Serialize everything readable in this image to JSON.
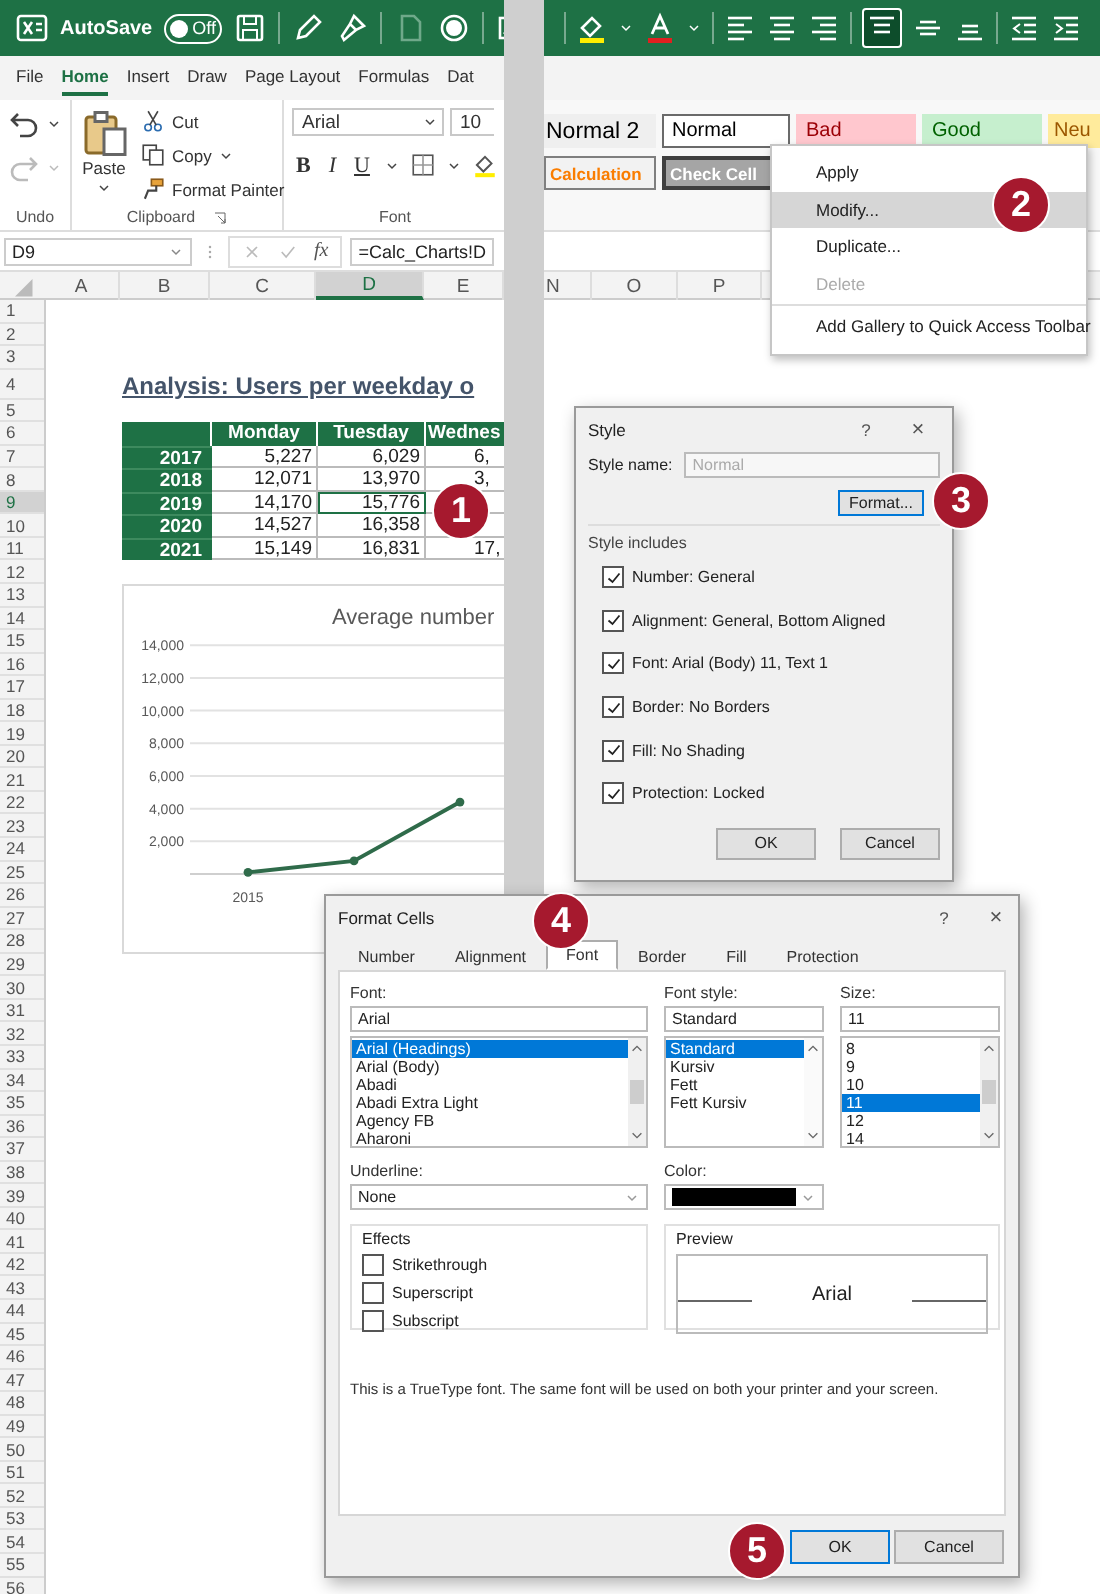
{
  "title_bar": {
    "autosave_label": "AutoSave",
    "autosave_state": "Off",
    "autosave_on": false,
    "vertical_align_buttons": [
      {
        "selected": true
      },
      {
        "selected": false
      },
      {
        "selected": false
      }
    ]
  },
  "menu_tabs": [
    {
      "label": "File",
      "selected": false
    },
    {
      "label": "Home",
      "selected": true
    },
    {
      "label": "Insert",
      "selected": false
    },
    {
      "label": "Draw",
      "selected": false
    },
    {
      "label": "Page Layout",
      "selected": false
    },
    {
      "label": "Formulas",
      "selected": false
    },
    {
      "label": "Dat",
      "selected": false
    }
  ],
  "ribbon": {
    "undo_group": "Undo",
    "paste": "Paste",
    "cut": "Cut",
    "copy": "Copy",
    "format_painter": "Format Painter",
    "clipboard_group": "Clipboard",
    "font_name": "Arial",
    "font_size": "10",
    "bold": "B",
    "italic": "I",
    "underline": "U",
    "font_group": "Font",
    "cell_styles": [
      {
        "label": "Normal 2",
        "kind": "plain",
        "selected": false
      },
      {
        "label": "Normal",
        "kind": "normal",
        "selected": true
      },
      {
        "label": "Bad",
        "kind": "bad",
        "selected": false
      },
      {
        "label": "Good",
        "kind": "good",
        "selected": false
      },
      {
        "label": "Neu",
        "kind": "neutral",
        "selected": false
      },
      {
        "label": "Calculation",
        "kind": "calculation",
        "selected": false
      },
      {
        "label": "Check Cell",
        "kind": "check",
        "selected": false
      }
    ]
  },
  "formula_bar": {
    "name_box": "D9",
    "fx": "fx",
    "formula": "=Calc_Charts!D"
  },
  "columns": [
    {
      "label": "A",
      "selected": false
    },
    {
      "label": "B",
      "selected": false
    },
    {
      "label": "C",
      "selected": false
    },
    {
      "label": "D",
      "selected": true
    },
    {
      "label": "E",
      "selected": false
    },
    {
      "label": "N",
      "selected": false
    },
    {
      "label": "O",
      "selected": false
    },
    {
      "label": "P",
      "selected": false
    }
  ],
  "rows": [
    {
      "label": "1",
      "selected": false
    },
    {
      "label": "2",
      "selected": false
    },
    {
      "label": "3",
      "selected": false
    },
    {
      "label": "4",
      "selected": false
    },
    {
      "label": "5",
      "selected": false
    },
    {
      "label": "6",
      "selected": false
    },
    {
      "label": "7",
      "selected": false
    },
    {
      "label": "8",
      "selected": false
    },
    {
      "label": "9",
      "selected": true
    },
    {
      "label": "10",
      "selected": false
    },
    {
      "label": "11",
      "selected": false
    },
    {
      "label": "12",
      "selected": false
    },
    {
      "label": "13",
      "selected": false
    },
    {
      "label": "14",
      "selected": false
    },
    {
      "label": "15",
      "selected": false
    },
    {
      "label": "16",
      "selected": false
    },
    {
      "label": "17",
      "selected": false
    },
    {
      "label": "18",
      "selected": false
    },
    {
      "label": "19",
      "selected": false
    },
    {
      "label": "20",
      "selected": false
    },
    {
      "label": "21",
      "selected": false
    },
    {
      "label": "22",
      "selected": false
    },
    {
      "label": "23",
      "selected": false
    },
    {
      "label": "24",
      "selected": false
    },
    {
      "label": "25",
      "selected": false
    },
    {
      "label": "26",
      "selected": false
    },
    {
      "label": "27",
      "selected": false
    },
    {
      "label": "28",
      "selected": false
    },
    {
      "label": "29",
      "selected": false
    },
    {
      "label": "30",
      "selected": false
    },
    {
      "label": "31",
      "selected": false
    },
    {
      "label": "32",
      "selected": false
    },
    {
      "label": "33",
      "selected": false
    },
    {
      "label": "34",
      "selected": false
    },
    {
      "label": "35",
      "selected": false
    },
    {
      "label": "36",
      "selected": false
    },
    {
      "label": "37",
      "selected": false
    },
    {
      "label": "38",
      "selected": false
    },
    {
      "label": "39",
      "selected": false
    },
    {
      "label": "40",
      "selected": false
    },
    {
      "label": "41",
      "selected": false
    },
    {
      "label": "42",
      "selected": false
    },
    {
      "label": "43",
      "selected": false
    },
    {
      "label": "44",
      "selected": false
    },
    {
      "label": "45",
      "selected": false
    },
    {
      "label": "46",
      "selected": false
    },
    {
      "label": "47",
      "selected": false
    },
    {
      "label": "48",
      "selected": false
    },
    {
      "label": "49",
      "selected": false
    },
    {
      "label": "50",
      "selected": false
    },
    {
      "label": "51",
      "selected": false
    },
    {
      "label": "52",
      "selected": false
    },
    {
      "label": "53",
      "selected": false
    },
    {
      "label": "54",
      "selected": false
    },
    {
      "label": "55",
      "selected": false
    },
    {
      "label": "56",
      "selected": false
    }
  ],
  "sheet": {
    "title": "Analysis: Users per weekday o",
    "table": {
      "headers": [
        "Monday",
        "Tuesday",
        "Wednes"
      ],
      "rows": [
        {
          "year": "2017",
          "cells": [
            {
              "text": "5,227",
              "selected": false
            },
            {
              "text": "6,029",
              "selected": false
            },
            {
              "text": "6,",
              "selected": false
            }
          ]
        },
        {
          "year": "2018",
          "cells": [
            {
              "text": "12,071",
              "selected": false
            },
            {
              "text": "13,970",
              "selected": false
            },
            {
              "text": "3,",
              "selected": false
            }
          ]
        },
        {
          "year": "2019",
          "cells": [
            {
              "text": "14,170",
              "selected": false
            },
            {
              "text": "15,776",
              "selected": true
            }
          ]
        },
        {
          "year": "2020",
          "cells": [
            {
              "text": "14,527",
              "selected": false
            },
            {
              "text": "16,358",
              "selected": false
            }
          ]
        },
        {
          "year": "2021",
          "cells": [
            {
              "text": "15,149",
              "selected": false
            },
            {
              "text": "16,831",
              "selected": false
            },
            {
              "text": "17,",
              "selected": false
            }
          ]
        }
      ]
    },
    "chart": {
      "chart_data": {
        "type": "line",
        "title": "Average number",
        "categories": [
          "2015",
          null,
          null,
          null
        ],
        "series": [
          {
            "color": "#2f6b4a",
            "marker": "circle",
            "values": [
              100,
              800,
              4400,
              null
            ]
          }
        ],
        "ylim": [
          0,
          14000
        ],
        "yticks": [
          {
            "value": 2000,
            "label": "2,000"
          },
          {
            "value": 4000,
            "label": "4,000"
          },
          {
            "value": 6000,
            "label": "6,000"
          },
          {
            "value": 8000,
            "label": "8,000"
          },
          {
            "value": 10000,
            "label": "10,000"
          },
          {
            "value": 12000,
            "label": "12,000"
          },
          {
            "value": 14000,
            "label": "14,000"
          }
        ],
        "data_labels": false,
        "grid": true
      }
    }
  },
  "context_menu": [
    {
      "label": "Apply",
      "selected": false,
      "disabled": false
    },
    {
      "label": "Modify...",
      "selected": true,
      "disabled": false
    },
    {
      "label": "Duplicate...",
      "selected": false,
      "disabled": false
    },
    {
      "label": "Delete",
      "selected": false,
      "disabled": true
    },
    {
      "label": "Add Gallery to Quick Access Toolbar",
      "selected": false,
      "disabled": false
    }
  ],
  "style_dialog": {
    "title": "Style",
    "help": "?",
    "close": "×",
    "name_label": "Style name:",
    "name_value": "Normal",
    "format_button": "Format...",
    "includes_label": "Style includes",
    "includes": [
      {
        "label": "Number: General",
        "checked": true
      },
      {
        "label": "Alignment: General, Bottom Aligned",
        "checked": true
      },
      {
        "label": "Font: Arial (Body) 11, Text 1",
        "checked": true
      },
      {
        "label": "Border: No Borders",
        "checked": true
      },
      {
        "label": "Fill: No Shading",
        "checked": true
      },
      {
        "label": "Protection: Locked",
        "checked": true
      }
    ],
    "ok": "OK",
    "cancel": "Cancel"
  },
  "format_cells": {
    "title": "Format Cells",
    "help": "?",
    "close": "×",
    "tabs": [
      {
        "label": "Number",
        "selected": false
      },
      {
        "label": "Alignment",
        "selected": false
      },
      {
        "label": "Font",
        "selected": true
      },
      {
        "label": "Border",
        "selected": false
      },
      {
        "label": "Fill",
        "selected": false
      },
      {
        "label": "Protection",
        "selected": false
      }
    ],
    "font_label": "Font:",
    "font_value": "Arial",
    "fonts": [
      {
        "label": "Arial (Headings)",
        "selected": true
      },
      {
        "label": "Arial (Body)",
        "selected": false
      },
      {
        "label": "Abadi",
        "selected": false
      },
      {
        "label": "Abadi Extra Light",
        "selected": false
      },
      {
        "label": "Agency FB",
        "selected": false
      },
      {
        "label": "Aharoni",
        "selected": false
      }
    ],
    "style_label": "Font style:",
    "style_value": "Standard",
    "styles": [
      {
        "label": "Standard",
        "selected": true
      },
      {
        "label": "Kursiv",
        "selected": false
      },
      {
        "label": "Fett",
        "selected": false
      },
      {
        "label": "Fett Kursiv",
        "selected": false
      }
    ],
    "size_label": "Size:",
    "size_value": "11",
    "sizes": [
      {
        "label": "8",
        "selected": false
      },
      {
        "label": "9",
        "selected": false
      },
      {
        "label": "10",
        "selected": false
      },
      {
        "label": "11",
        "selected": true
      },
      {
        "label": "12",
        "selected": false
      },
      {
        "label": "14",
        "selected": false
      }
    ],
    "underline_label": "Underline:",
    "underline_value": "None",
    "color_label": "Color:",
    "color": "#000000",
    "effects_label": "Effects",
    "effects": [
      {
        "label": "Strikethrough",
        "checked": false
      },
      {
        "label": "Superscript",
        "checked": false
      },
      {
        "label": "Subscript",
        "checked": false
      }
    ],
    "preview_label": "Preview",
    "preview_text": "Arial",
    "note": "This is a TrueType font.  The same font will be used on both your printer and your screen.",
    "ok": "OK",
    "cancel": "Cancel"
  },
  "badges": [
    "1",
    "2",
    "3",
    "4",
    "5"
  ]
}
